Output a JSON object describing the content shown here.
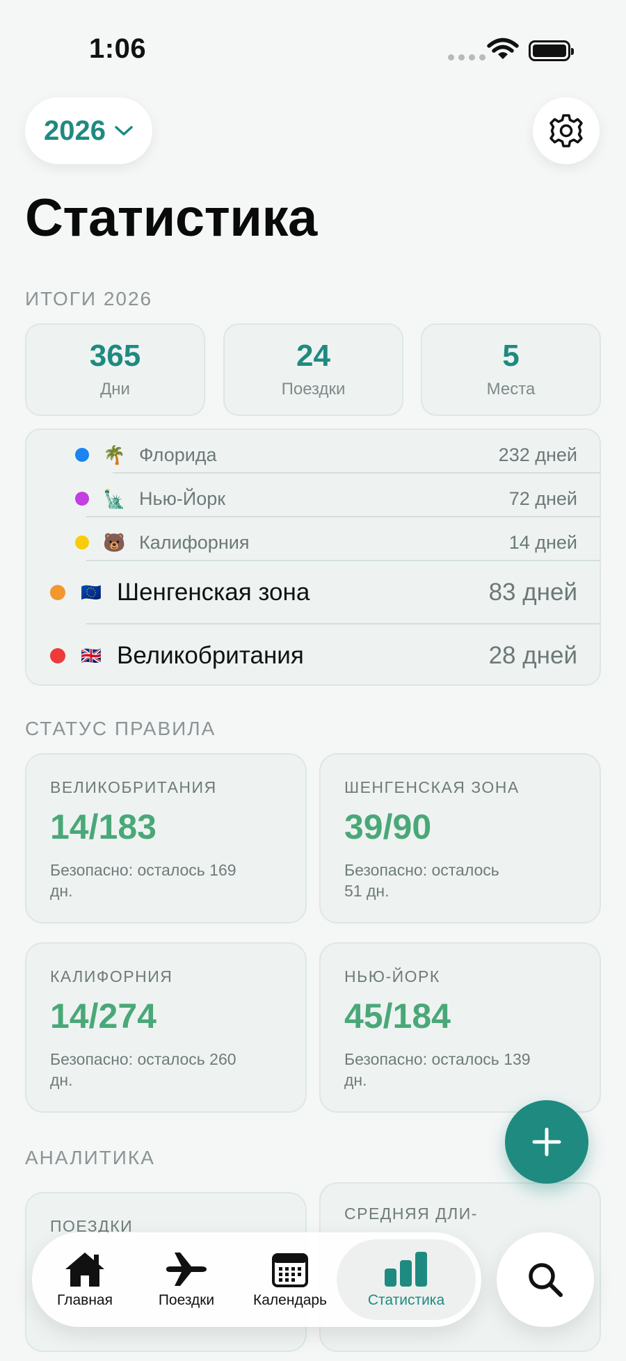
{
  "status_bar": {
    "time": "1:06"
  },
  "header": {
    "year": "2026",
    "title": "Статистика"
  },
  "summary": {
    "section_title": "ИТОГИ 2026",
    "tiles": [
      {
        "value": "365",
        "label": "Дни"
      },
      {
        "value": "24",
        "label": "Поездки"
      },
      {
        "value": "5",
        "label": "Места"
      }
    ]
  },
  "places": {
    "sub": [
      {
        "flag": "🌴",
        "name": "Флорида",
        "days": "232 дней",
        "color": "#1a84f0"
      },
      {
        "flag": "🗽",
        "name": "Нью-Йорк",
        "days": "72 дней",
        "color": "#c33fe0"
      },
      {
        "flag": "🐻",
        "name": "Калифорния",
        "days": "14 дней",
        "color": "#f8cc0a"
      }
    ],
    "main": [
      {
        "flag": "🇪🇺",
        "name": "Шенгенская зона",
        "days": "83 дней",
        "color": "#f4962e"
      },
      {
        "flag": "🇬🇧",
        "name": "Великобритания",
        "days": "28 дней",
        "color": "#ee3a3a"
      }
    ]
  },
  "rules": {
    "section_title": "СТАТУС ПРАВИЛА",
    "cards": [
      {
        "name": "ВЕЛИКОБРИТАНИЯ",
        "value": "14/183",
        "status_line1": "Безопасно: осталось 169",
        "status_line2": "дн."
      },
      {
        "name": "ШЕНГЕНСКАЯ ЗОНА",
        "value": "39/90",
        "status_line1": "Безопасно: осталось",
        "status_line2": "51 дн."
      },
      {
        "name": "КАЛИФОРНИЯ",
        "value": "14/274",
        "status_line1": "Безопасно: осталось 260",
        "status_line2": "дн."
      },
      {
        "name": "НЬЮ-ЙОРК",
        "value": "45/184",
        "status_line1": "Безопасно: осталось 139",
        "status_line2": "дн."
      }
    ]
  },
  "analytics": {
    "section_title": "АНАЛИТИКА",
    "cards": [
      {
        "name": "ПОЕЗДКИ"
      },
      {
        "name": "СРЕДНЯЯ ДЛИ-"
      }
    ]
  },
  "tabbar": {
    "tabs": [
      {
        "label": "Главная",
        "icon": "house-icon"
      },
      {
        "label": "Поездки",
        "icon": "airplane-icon"
      },
      {
        "label": "Календарь",
        "icon": "calendar-icon"
      },
      {
        "label": "Статистика",
        "icon": "bar-chart-icon"
      }
    ],
    "active": "Статистика",
    "accent": "#1e8a80"
  }
}
